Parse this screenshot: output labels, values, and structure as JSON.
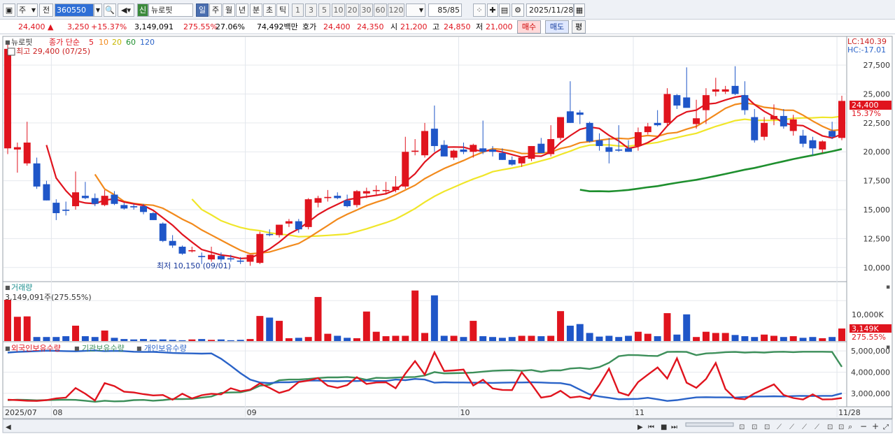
{
  "toolbar": {
    "mode_label": "주",
    "prev_label": "전",
    "code": "360550",
    "new_tag": "신",
    "stock_name": "뉴로핏",
    "periods": [
      "일",
      "주",
      "월",
      "년",
      "분",
      "초",
      "틱"
    ],
    "active_period": "일",
    "intervals": [
      "1",
      "3",
      "5",
      "10",
      "20",
      "30",
      "60",
      "120"
    ],
    "count": "85",
    "count_total": "/85",
    "date": "2025/11/28"
  },
  "quote": {
    "price": "24,400",
    "change": "3,250",
    "change_pct": "+15.37%",
    "volume": "3,149,091",
    "volume_pct": "275.55%",
    "turnover": "27.06%",
    "amount": "74,492백만",
    "ask_label": "호가",
    "ask": "24,400",
    "bid": "24,350",
    "open_label": "시",
    "open": "21,200",
    "high_label": "고",
    "high": "24,850",
    "low_label": "저",
    "low": "21,000",
    "buy_label": "매수",
    "sell_label": "매도",
    "eval_label": "평"
  },
  "chart_data": [
    {
      "type": "candlestick",
      "title": "뉴로핏",
      "ma_label": "종가 단순",
      "legend": [
        {
          "name": "5",
          "color": "#e0141e"
        },
        {
          "name": "10",
          "color": "#f28a1c"
        },
        {
          "name": "20",
          "color": "#f0e62a"
        },
        {
          "name": "60",
          "color": "#1e8f2e"
        },
        {
          "name": "120",
          "color": "#2a63c8"
        }
      ],
      "high_annotation": "최고 29,400 (07/25)",
      "low_annotation": "최저 10,150 (09/01)",
      "lc_label": "LC:140.39",
      "hc_label": "HC:-17.01",
      "last_price_label": "24,400",
      "last_pct_label": "15.37%",
      "ylim": [
        8900,
        29800
      ],
      "y_ticks": [
        {
          "value": 10000,
          "label": "10,000"
        },
        {
          "value": 12500,
          "label": "12,500"
        },
        {
          "value": 15000,
          "label": "15,000"
        },
        {
          "value": 17500,
          "label": "17,500"
        },
        {
          "value": 20000,
          "label": "20,000"
        },
        {
          "value": 22500,
          "label": "22,500"
        },
        {
          "value": 25000,
          "label": "25,000"
        },
        {
          "value": 27500,
          "label": "27,500"
        }
      ],
      "x_labels": [
        {
          "index": 0,
          "label": "2025/07"
        },
        {
          "index": 5,
          "label": "08"
        },
        {
          "index": 25,
          "label": "09"
        },
        {
          "index": 47,
          "label": "10"
        },
        {
          "index": 65,
          "label": "11"
        },
        {
          "index": 86,
          "label": "11/28"
        }
      ],
      "candles": [
        {
          "o": 20300,
          "h": 29400,
          "l": 19800,
          "c": 28900
        },
        {
          "o": 20200,
          "h": 20800,
          "l": 18200,
          "c": 20400
        },
        {
          "o": 19000,
          "h": 22600,
          "l": 18800,
          "c": 20800
        },
        {
          "o": 19000,
          "h": 19500,
          "l": 16800,
          "c": 17000
        },
        {
          "o": 17200,
          "h": 17500,
          "l": 15800,
          "c": 15800
        },
        {
          "o": 15600,
          "h": 15900,
          "l": 14100,
          "c": 14700
        },
        {
          "o": 15000,
          "h": 15700,
          "l": 14500,
          "c": 14900
        },
        {
          "o": 15300,
          "h": 18300,
          "l": 15000,
          "c": 16500
        },
        {
          "o": 16200,
          "h": 17400,
          "l": 15900,
          "c": 16000
        },
        {
          "o": 16000,
          "h": 16400,
          "l": 15300,
          "c": 15500
        },
        {
          "o": 15400,
          "h": 16700,
          "l": 15300,
          "c": 16200
        },
        {
          "o": 16300,
          "h": 16600,
          "l": 15400,
          "c": 15500
        },
        {
          "o": 15400,
          "h": 15600,
          "l": 15000,
          "c": 15100
        },
        {
          "o": 15300,
          "h": 15500,
          "l": 15000,
          "c": 15200
        },
        {
          "o": 15300,
          "h": 15500,
          "l": 14600,
          "c": 14800
        },
        {
          "o": 14700,
          "h": 14800,
          "l": 14100,
          "c": 14100
        },
        {
          "o": 13800,
          "h": 13900,
          "l": 12200,
          "c": 12300
        },
        {
          "o": 12300,
          "h": 12800,
          "l": 11700,
          "c": 11900
        },
        {
          "o": 11800,
          "h": 11900,
          "l": 11100,
          "c": 11200
        },
        {
          "o": 11400,
          "h": 11800,
          "l": 11300,
          "c": 11500
        },
        {
          "o": 11000,
          "h": 11300,
          "l": 10300,
          "c": 10900
        },
        {
          "o": 10700,
          "h": 11800,
          "l": 10500,
          "c": 11100
        },
        {
          "o": 11000,
          "h": 11300,
          "l": 10500,
          "c": 10700
        },
        {
          "o": 10800,
          "h": 11100,
          "l": 10500,
          "c": 10700
        },
        {
          "o": 10600,
          "h": 10900,
          "l": 10300,
          "c": 10500
        },
        {
          "o": 10500,
          "h": 10900,
          "l": 10150,
          "c": 11100
        },
        {
          "o": 10400,
          "h": 13100,
          "l": 10300,
          "c": 12900
        },
        {
          "o": 12900,
          "h": 13300,
          "l": 12700,
          "c": 12800
        },
        {
          "o": 12800,
          "h": 13600,
          "l": 12600,
          "c": 13700
        },
        {
          "o": 13800,
          "h": 14200,
          "l": 13500,
          "c": 14000
        },
        {
          "o": 14000,
          "h": 14200,
          "l": 13000,
          "c": 13300
        },
        {
          "o": 13500,
          "h": 16000,
          "l": 13300,
          "c": 15900
        },
        {
          "o": 15600,
          "h": 16200,
          "l": 15200,
          "c": 16000
        },
        {
          "o": 16000,
          "h": 16700,
          "l": 15700,
          "c": 16100
        },
        {
          "o": 16200,
          "h": 16500,
          "l": 15900,
          "c": 16000
        },
        {
          "o": 15800,
          "h": 16300,
          "l": 15200,
          "c": 15300
        },
        {
          "o": 15400,
          "h": 16700,
          "l": 15200,
          "c": 16600
        },
        {
          "o": 16400,
          "h": 16900,
          "l": 16000,
          "c": 16600
        },
        {
          "o": 16600,
          "h": 17100,
          "l": 16300,
          "c": 16700
        },
        {
          "o": 16600,
          "h": 17400,
          "l": 16300,
          "c": 16700
        },
        {
          "o": 16700,
          "h": 17900,
          "l": 16500,
          "c": 17000
        },
        {
          "o": 17000,
          "h": 21300,
          "l": 16800,
          "c": 20000
        },
        {
          "o": 20000,
          "h": 21100,
          "l": 19700,
          "c": 20100
        },
        {
          "o": 19700,
          "h": 22500,
          "l": 19500,
          "c": 21800
        },
        {
          "o": 22000,
          "h": 24000,
          "l": 20000,
          "c": 20500
        },
        {
          "o": 20600,
          "h": 21000,
          "l": 19700,
          "c": 19600
        },
        {
          "o": 19500,
          "h": 20200,
          "l": 19300,
          "c": 20100
        },
        {
          "o": 20200,
          "h": 20800,
          "l": 19800,
          "c": 20000
        },
        {
          "o": 20000,
          "h": 20700,
          "l": 19500,
          "c": 20600
        },
        {
          "o": 20300,
          "h": 22700,
          "l": 19800,
          "c": 20000
        },
        {
          "o": 20200,
          "h": 20500,
          "l": 19600,
          "c": 20000
        },
        {
          "o": 19900,
          "h": 20300,
          "l": 19300,
          "c": 19300
        },
        {
          "o": 19300,
          "h": 19600,
          "l": 18800,
          "c": 18900
        },
        {
          "o": 19000,
          "h": 19500,
          "l": 18700,
          "c": 19500
        },
        {
          "o": 19400,
          "h": 20500,
          "l": 19200,
          "c": 20500
        },
        {
          "o": 20700,
          "h": 21200,
          "l": 19900,
          "c": 19900
        },
        {
          "o": 19800,
          "h": 22300,
          "l": 19600,
          "c": 21100
        },
        {
          "o": 21200,
          "h": 23000,
          "l": 21000,
          "c": 23000
        },
        {
          "o": 23500,
          "h": 26100,
          "l": 22500,
          "c": 22500
        },
        {
          "o": 23400,
          "h": 23600,
          "l": 22400,
          "c": 23200
        },
        {
          "o": 22500,
          "h": 22600,
          "l": 20800,
          "c": 20900
        },
        {
          "o": 21000,
          "h": 21600,
          "l": 20100,
          "c": 20500
        },
        {
          "o": 20400,
          "h": 21200,
          "l": 19000,
          "c": 20000
        },
        {
          "o": 20200,
          "h": 22300,
          "l": 20000,
          "c": 20100
        },
        {
          "o": 20300,
          "h": 21000,
          "l": 20000,
          "c": 20000
        },
        {
          "o": 20500,
          "h": 22100,
          "l": 20100,
          "c": 21700
        },
        {
          "o": 21700,
          "h": 22500,
          "l": 21500,
          "c": 22200
        },
        {
          "o": 22500,
          "h": 23600,
          "l": 22200,
          "c": 22300
        },
        {
          "o": 22500,
          "h": 25500,
          "l": 22300,
          "c": 25000
        },
        {
          "o": 24900,
          "h": 25000,
          "l": 23700,
          "c": 24000
        },
        {
          "o": 24700,
          "h": 27300,
          "l": 23900,
          "c": 23800
        },
        {
          "o": 22400,
          "h": 24500,
          "l": 22000,
          "c": 22900
        },
        {
          "o": 23600,
          "h": 25500,
          "l": 22400,
          "c": 24900
        },
        {
          "o": 25200,
          "h": 26400,
          "l": 24800,
          "c": 25400
        },
        {
          "o": 25200,
          "h": 25700,
          "l": 25000,
          "c": 25400
        },
        {
          "o": 25700,
          "h": 27400,
          "l": 24900,
          "c": 25000
        },
        {
          "o": 24900,
          "h": 26100,
          "l": 23200,
          "c": 23600
        },
        {
          "o": 23000,
          "h": 23700,
          "l": 20800,
          "c": 21000
        },
        {
          "o": 21300,
          "h": 23000,
          "l": 21000,
          "c": 22500
        },
        {
          "o": 22800,
          "h": 24100,
          "l": 22300,
          "c": 23100
        },
        {
          "o": 23100,
          "h": 23700,
          "l": 22000,
          "c": 22200
        },
        {
          "o": 21800,
          "h": 23200,
          "l": 21400,
          "c": 22800
        },
        {
          "o": 21400,
          "h": 21900,
          "l": 20400,
          "c": 20700
        },
        {
          "o": 21000,
          "h": 21300,
          "l": 19700,
          "c": 20300
        },
        {
          "o": 20200,
          "h": 21000,
          "l": 19900,
          "c": 20900
        },
        {
          "o": 21800,
          "h": 22600,
          "l": 21100,
          "c": 21300
        },
        {
          "o": 21200,
          "h": 24850,
          "l": 21000,
          "c": 24400
        }
      ]
    },
    {
      "type": "bar",
      "title": "거래량",
      "value_label": "3,149,091주(275.55%)",
      "y_tick_label": "10,000K",
      "y_tick_value": 10000,
      "last_label": "3,149K",
      "last_pct_label": "275.55%",
      "ymax": 14000,
      "unit": "K",
      "values": [
        10200,
        6000,
        6100,
        1000,
        1000,
        1000,
        1200,
        3800,
        1200,
        1000,
        2600,
        800,
        500,
        400,
        500,
        300,
        400,
        300,
        200,
        400,
        500,
        300,
        400,
        200,
        300,
        500,
        6200,
        5800,
        5000,
        700,
        800,
        1000,
        10900,
        1800,
        1300,
        800,
        700,
        7300,
        2300,
        1200,
        1300,
        1300,
        12500,
        2000,
        11300,
        1300,
        1300,
        1000,
        5000,
        1200,
        1000,
        800,
        1000,
        1300,
        1300,
        1200,
        1300,
        7400,
        3800,
        4200,
        2000,
        1100,
        1300,
        1000,
        1300,
        2300,
        1800,
        1200,
        6900,
        1600,
        6600,
        1000,
        2300,
        2000,
        2000,
        1500,
        1200,
        1000,
        1600,
        1300,
        1000,
        1200,
        800,
        1000,
        700,
        1000,
        3100
      ]
    },
    {
      "type": "line",
      "title": "외국인보유수량",
      "series": [
        {
          "name": "외국인보유수량",
          "color": "#e0141e"
        },
        {
          "name": "기관보유수량",
          "color": "#3d8f5a"
        },
        {
          "name": "개인보유수량",
          "color": "#2a63c8"
        }
      ],
      "ylim": [
        2400000,
        5300000
      ],
      "y_ticks": [
        {
          "value": 3000000,
          "label": "3,000,000"
        },
        {
          "value": 4000000,
          "label": "4,000,000"
        },
        {
          "value": 5000000,
          "label": "5,000,000"
        }
      ]
    }
  ],
  "series_values": {
    "red": [
      2700000,
      2680000,
      2650000,
      2640000,
      2680000,
      2760000,
      2800000,
      3250000,
      2980000,
      2660000,
      3480000,
      3340000,
      3080000,
      3040000,
      2960000,
      2900000,
      2920000,
      2700000,
      2980000,
      2760000,
      2910000,
      2980000,
      2950000,
      3240000,
      3100000,
      3170000,
      3470000,
      3260000,
      3020000,
      3150000,
      3530000,
      3600000,
      3720000,
      3360000,
      3260000,
      3390000,
      3760000,
      3440000,
      3510000,
      3520000,
      3240000,
      3930000,
      4520000,
      3880000,
      4930000,
      4050000,
      4080000,
      4120000,
      3370000,
      3640000,
      3230000,
      3160000,
      3150000,
      3990000,
      3430000,
      2800000,
      2870000,
      3120000,
      2800000,
      2850000,
      2740000,
      3400000,
      4160000,
      3050000,
      2900000,
      3530000,
      3880000,
      4220000,
      3700000,
      4650000,
      3500000,
      3260000,
      3680000,
      4430000,
      3200000,
      2760000,
      2720000,
      3000000,
      3210000,
      3420000,
      2920000,
      2780000,
      2710000,
      2950000,
      2710000,
      2720000,
      2780000
    ],
    "green": [
      2680000,
      2700000,
      2690000,
      2670000,
      2680000,
      2690000,
      2700000,
      2690000,
      2650000,
      2600000,
      2650000,
      2620000,
      2630000,
      2680000,
      2690000,
      2650000,
      2680000,
      2730000,
      2730000,
      2740000,
      2800000,
      2850000,
      3020000,
      3040000,
      3050000,
      3150000,
      3360000,
      3410000,
      3620000,
      3650000,
      3650000,
      3680000,
      3720000,
      3750000,
      3750000,
      3770000,
      3730000,
      3640000,
      3730000,
      3720000,
      3740000,
      3760000,
      3770000,
      3840000,
      4000000,
      3940000,
      3950000,
      3960000,
      3980000,
      4020000,
      4060000,
      4080000,
      4090000,
      4060000,
      4100000,
      4010000,
      4080000,
      4080000,
      4170000,
      4200000,
      4150000,
      4240000,
      4440000,
      4750000,
      4810000,
      4800000,
      4770000,
      4760000,
      4950000,
      4960000,
      4950000,
      4800000,
      4880000,
      4900000,
      4940000,
      4950000,
      4920000,
      4940000,
      4920000,
      4950000,
      4960000,
      4940000,
      4960000,
      4960000,
      4960000,
      4950000,
      4250000
    ],
    "blue": [
      4920000,
      4950000,
      4970000,
      4990000,
      5010000,
      5000000,
      4990000,
      4980000,
      5000000,
      5020000,
      4990000,
      5000000,
      4990000,
      4960000,
      4950000,
      4950000,
      4930000,
      4900000,
      4890000,
      4880000,
      4870000,
      4880000,
      4630000,
      4300000,
      3950000,
      3650000,
      3510000,
      3480000,
      3520000,
      3520000,
      3550000,
      3600000,
      3600000,
      3580000,
      3570000,
      3580000,
      3580000,
      3600000,
      3580000,
      3580000,
      3650000,
      3620000,
      3680000,
      3650000,
      3500000,
      3520000,
      3510000,
      3510000,
      3500000,
      3500000,
      3490000,
      3500000,
      3510000,
      3510000,
      3520000,
      3510000,
      3490000,
      3480000,
      3400000,
      3170000,
      2950000,
      2850000,
      2790000,
      2720000,
      2730000,
      2740000,
      2790000,
      2720000,
      2640000,
      2680000,
      2750000,
      2810000,
      2820000,
      2810000,
      2810000,
      2800000,
      2830000,
      2850000,
      2850000,
      2860000,
      2850000,
      2870000,
      2880000,
      2870000,
      2880000,
      2880000,
      3000000
    ]
  },
  "bottom_bar": {
    "icons": [
      "scroll-left-icon",
      "scroll-right-icon",
      "first-icon",
      "stop-icon",
      "last-icon",
      "zoom-icon",
      "minus-icon",
      "plus-icon"
    ]
  }
}
